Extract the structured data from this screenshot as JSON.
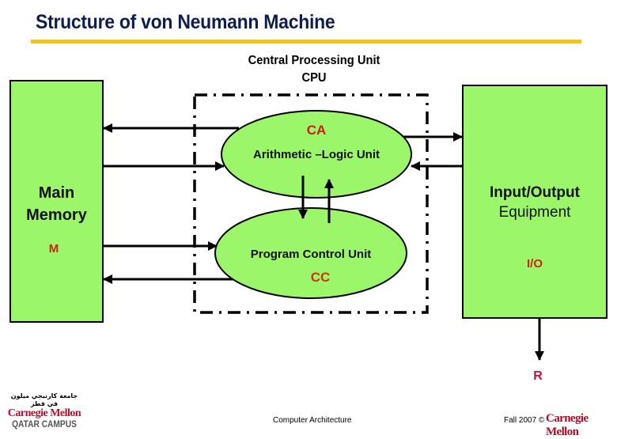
{
  "title": "Structure of von Neumann Machine",
  "colors": {
    "title": "#0e1e4e",
    "title_rule": "#f3c41b",
    "block_fill": "#9cf66a",
    "code_red": "#d01c10",
    "brand_red": "#a80f26"
  },
  "cpu": {
    "label_line1": "Central Processing Unit",
    "label_line2": "CPU"
  },
  "main_memory": {
    "title_line1": "Main",
    "title_line2": "Memory",
    "code": "M"
  },
  "io": {
    "title": "Input/Output",
    "subtitle": "Equipment",
    "code": "I/O",
    "output_label": "R"
  },
  "alu": {
    "code": "CA",
    "label": "Arithmetic –Logic Unit"
  },
  "control": {
    "label": "Program Control Unit",
    "code": "CC"
  },
  "connections": [
    {
      "from": "CA",
      "to": "M"
    },
    {
      "from": "M",
      "to": "CA"
    },
    {
      "from": "M",
      "to": "CC"
    },
    {
      "from": "CC",
      "to": "M"
    },
    {
      "from": "CA",
      "to": "I/O"
    },
    {
      "from": "I/O",
      "to": "CA"
    },
    {
      "from": "CA",
      "to": "CC"
    },
    {
      "from": "CC",
      "to": "CA"
    },
    {
      "from": "I/O",
      "to": "R"
    }
  ],
  "footer": {
    "logo_arabic": "جامعة كارنيجي ميلون في قطر",
    "logo_name": "Carnegie Mellon",
    "logo_campus": "QATAR CAMPUS",
    "course": "Computer Architecture",
    "term": "Fall 2007 ©",
    "brand": "Carnegie Mellon"
  }
}
